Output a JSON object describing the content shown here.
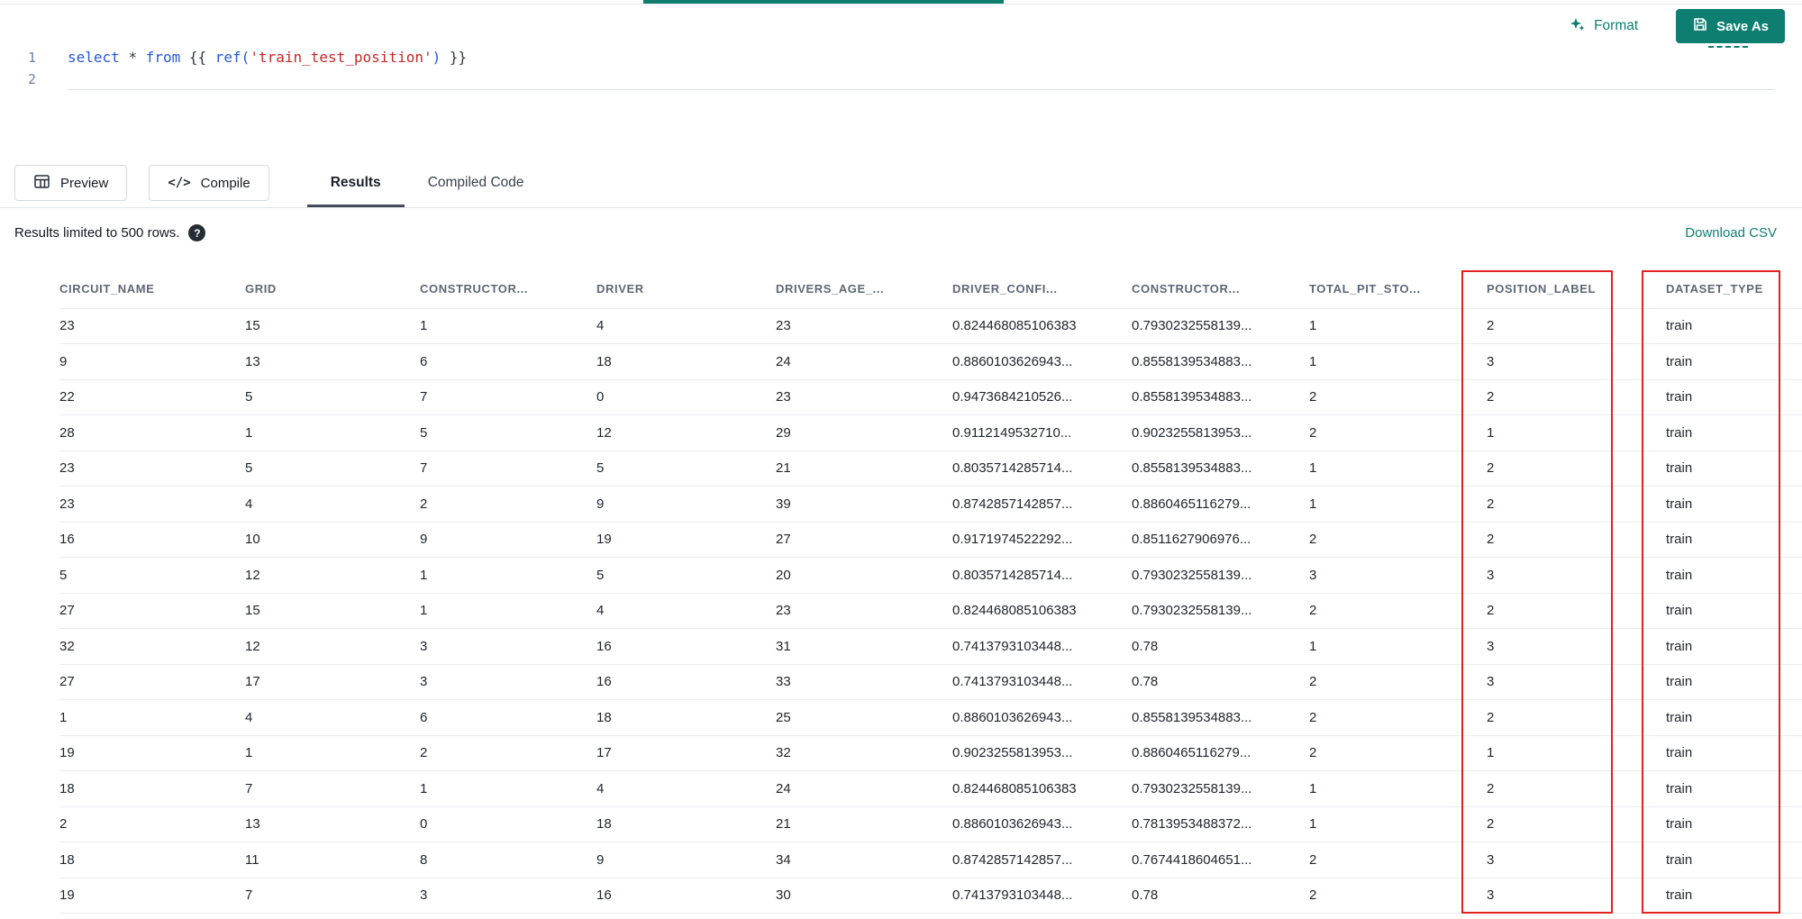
{
  "top_bar": {
    "format_label": "Format",
    "save_as_label": "Save As",
    "accent_color": "#0E7E71"
  },
  "editor": {
    "line_numbers": [
      "1",
      "2"
    ],
    "tokens": [
      {
        "text": "select",
        "type": "keyword"
      },
      {
        "text": " ",
        "type": "plain"
      },
      {
        "text": "*",
        "type": "operator"
      },
      {
        "text": " ",
        "type": "plain"
      },
      {
        "text": "from",
        "type": "keyword"
      },
      {
        "text": " {{ ",
        "type": "plain"
      },
      {
        "text": "ref(",
        "type": "function"
      },
      {
        "text": "'train_test_position'",
        "type": "string"
      },
      {
        "text": ")",
        "type": "function"
      },
      {
        "text": " }}",
        "type": "plain"
      }
    ]
  },
  "toolbar": {
    "preview_label": "Preview",
    "compile_label": "Compile"
  },
  "tabs": [
    {
      "label": "Results",
      "active": true
    },
    {
      "label": "Compiled Code",
      "active": false
    }
  ],
  "results_bar": {
    "limit_text": "Results limited to 500 rows.",
    "help_icon": "?",
    "download_label": "Download CSV"
  },
  "table": {
    "columns": [
      "CIRCUIT_NAME",
      "GRID",
      "CONSTRUCTOR...",
      "DRIVER",
      "DRIVERS_AGE_...",
      "DRIVER_CONFI...",
      "CONSTRUCTOR...",
      "TOTAL_PIT_STO...",
      "POSITION_LABEL",
      "DATASET_TYPE"
    ],
    "rows": [
      [
        "23",
        "15",
        "1",
        "4",
        "23",
        "0.824468085106383",
        "0.7930232558139...",
        "1",
        "2",
        "train"
      ],
      [
        "9",
        "13",
        "6",
        "18",
        "24",
        "0.8860103626943...",
        "0.8558139534883...",
        "1",
        "3",
        "train"
      ],
      [
        "22",
        "5",
        "7",
        "0",
        "23",
        "0.9473684210526...",
        "0.8558139534883...",
        "2",
        "2",
        "train"
      ],
      [
        "28",
        "1",
        "5",
        "12",
        "29",
        "0.9112149532710...",
        "0.9023255813953...",
        "2",
        "1",
        "train"
      ],
      [
        "23",
        "5",
        "7",
        "5",
        "21",
        "0.8035714285714...",
        "0.8558139534883...",
        "1",
        "2",
        "train"
      ],
      [
        "23",
        "4",
        "2",
        "9",
        "39",
        "0.8742857142857...",
        "0.8860465116279...",
        "1",
        "2",
        "train"
      ],
      [
        "16",
        "10",
        "9",
        "19",
        "27",
        "0.9171974522292...",
        "0.8511627906976...",
        "2",
        "2",
        "train"
      ],
      [
        "5",
        "12",
        "1",
        "5",
        "20",
        "0.8035714285714...",
        "0.7930232558139...",
        "3",
        "3",
        "train"
      ],
      [
        "27",
        "15",
        "1",
        "4",
        "23",
        "0.824468085106383",
        "0.7930232558139...",
        "2",
        "2",
        "train"
      ],
      [
        "32",
        "12",
        "3",
        "16",
        "31",
        "0.7413793103448...",
        "0.78",
        "1",
        "3",
        "train"
      ],
      [
        "27",
        "17",
        "3",
        "16",
        "33",
        "0.7413793103448...",
        "0.78",
        "2",
        "3",
        "train"
      ],
      [
        "1",
        "4",
        "6",
        "18",
        "25",
        "0.8860103626943...",
        "0.8558139534883...",
        "2",
        "2",
        "train"
      ],
      [
        "19",
        "1",
        "2",
        "17",
        "32",
        "0.9023255813953...",
        "0.8860465116279...",
        "2",
        "1",
        "train"
      ],
      [
        "18",
        "7",
        "1",
        "4",
        "24",
        "0.824468085106383",
        "0.7930232558139...",
        "1",
        "2",
        "train"
      ],
      [
        "2",
        "13",
        "0",
        "18",
        "21",
        "0.8860103626943...",
        "0.7813953488372...",
        "1",
        "2",
        "train"
      ],
      [
        "18",
        "11",
        "8",
        "9",
        "34",
        "0.8742857142857...",
        "0.7674418604651...",
        "2",
        "3",
        "train"
      ],
      [
        "19",
        "7",
        "3",
        "16",
        "30",
        "0.7413793103448...",
        "0.78",
        "2",
        "3",
        "train"
      ]
    ],
    "annotations": {
      "highlight_color": "#E0231C",
      "highlighted_columns": [
        "POSITION_LABEL",
        "DATASET_TYPE"
      ]
    }
  }
}
